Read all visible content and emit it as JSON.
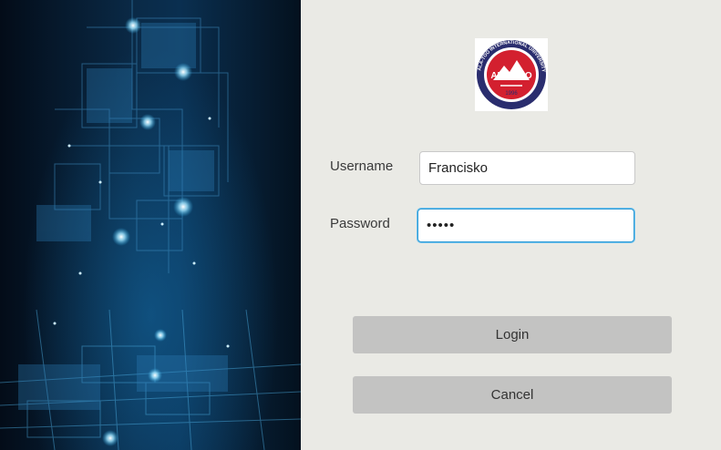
{
  "background": {
    "image_name": "circuit-network-background"
  },
  "logo": {
    "name": "ala-too-university-logo",
    "brand_text": "ALA-TOO",
    "ring_text": "ALA-TOO INTERNATIONAL UNIVERSITY",
    "year": "1996",
    "colors": {
      "red": "#d3202f",
      "navy": "#2a2d6e"
    }
  },
  "form": {
    "username_label": "Username",
    "username_value": "Francisko",
    "password_label": "Password",
    "password_value": "•••••"
  },
  "buttons": {
    "login_label": "Login",
    "cancel_label": "Cancel"
  },
  "colors": {
    "page_bg": "#eaeae5",
    "button_bg": "#c3c3c2",
    "focus_border": "#2f9bd6"
  }
}
